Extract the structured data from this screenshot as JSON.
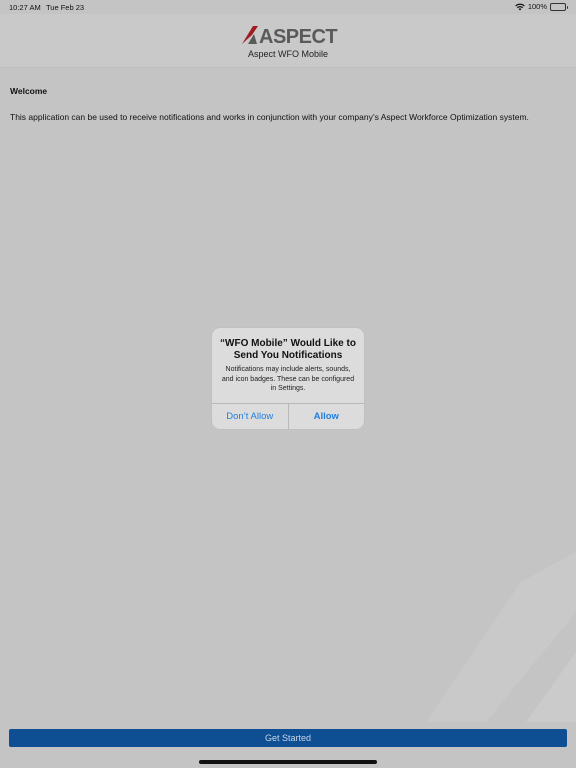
{
  "status_bar": {
    "time": "10:27 AM",
    "date": "Tue Feb 23",
    "battery": "100%",
    "wifi_icon": "wifi-icon",
    "battery_icon": "battery-icon"
  },
  "header": {
    "logo_text": "ASPECT",
    "app_title": "Aspect WFO Mobile"
  },
  "content": {
    "heading": "Welcome",
    "body": "This application can be used to receive notifications and works in conjunction with your company’s Aspect Workforce Optimization system."
  },
  "dialog": {
    "title": "“WFO Mobile” Would Like to Send You Notifications",
    "message": "Notifications may include alerts, sounds, and icon badges. These can be configured in Settings.",
    "dont_allow_label": "Don’t Allow",
    "allow_label": "Allow"
  },
  "footer": {
    "get_started_label": "Get Started"
  },
  "colors": {
    "accent_blue": "#1f7fe0",
    "button_blue": "#0e4f94",
    "logo_red": "#a01c22",
    "logo_gray": "#5a5a5a",
    "background": "#c4c4c4"
  }
}
